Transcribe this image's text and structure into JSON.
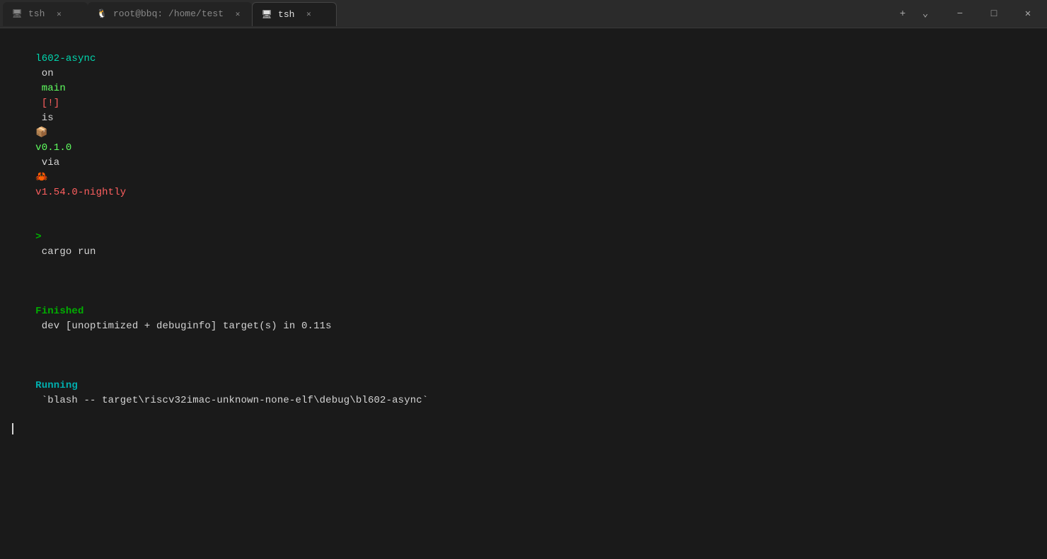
{
  "window": {
    "title": "tsh",
    "minimize_label": "−",
    "maximize_label": "□",
    "close_label": "✕"
  },
  "tabs": [
    {
      "id": "tab1",
      "icon": "🖥",
      "label": "tsh",
      "active": false,
      "close": "✕"
    },
    {
      "id": "tab2",
      "icon": "🐧",
      "label": "root@bbq: /home/test",
      "active": false,
      "close": "✕"
    },
    {
      "id": "tab3",
      "icon": "🖥",
      "label": "tsh",
      "active": true,
      "close": "✕"
    }
  ],
  "tab_bar": {
    "add_label": "+",
    "chevron_label": "⌄"
  },
  "terminal": {
    "prompt_line": {
      "project": "l602-async",
      "on": "on",
      "branch_icon": "ꞵ",
      "branch": "main",
      "exclamation": "[!]",
      "is": "is",
      "package_icon": "📦",
      "version": "v0.1.0",
      "via": "via",
      "rust_icon": "🦀",
      "rust_version": "v1.54.0-nightly"
    },
    "command": "cargo run",
    "output_lines": [
      {
        "type": "finished",
        "label": "Finished",
        "text": " dev [unoptimized + debuginfo] target(s) in 0.11s"
      },
      {
        "type": "running",
        "label": "Running",
        "text": " `blash -- target\\riscv32imac-unknown-none-elf\\debug\\bl602-async`"
      }
    ]
  }
}
